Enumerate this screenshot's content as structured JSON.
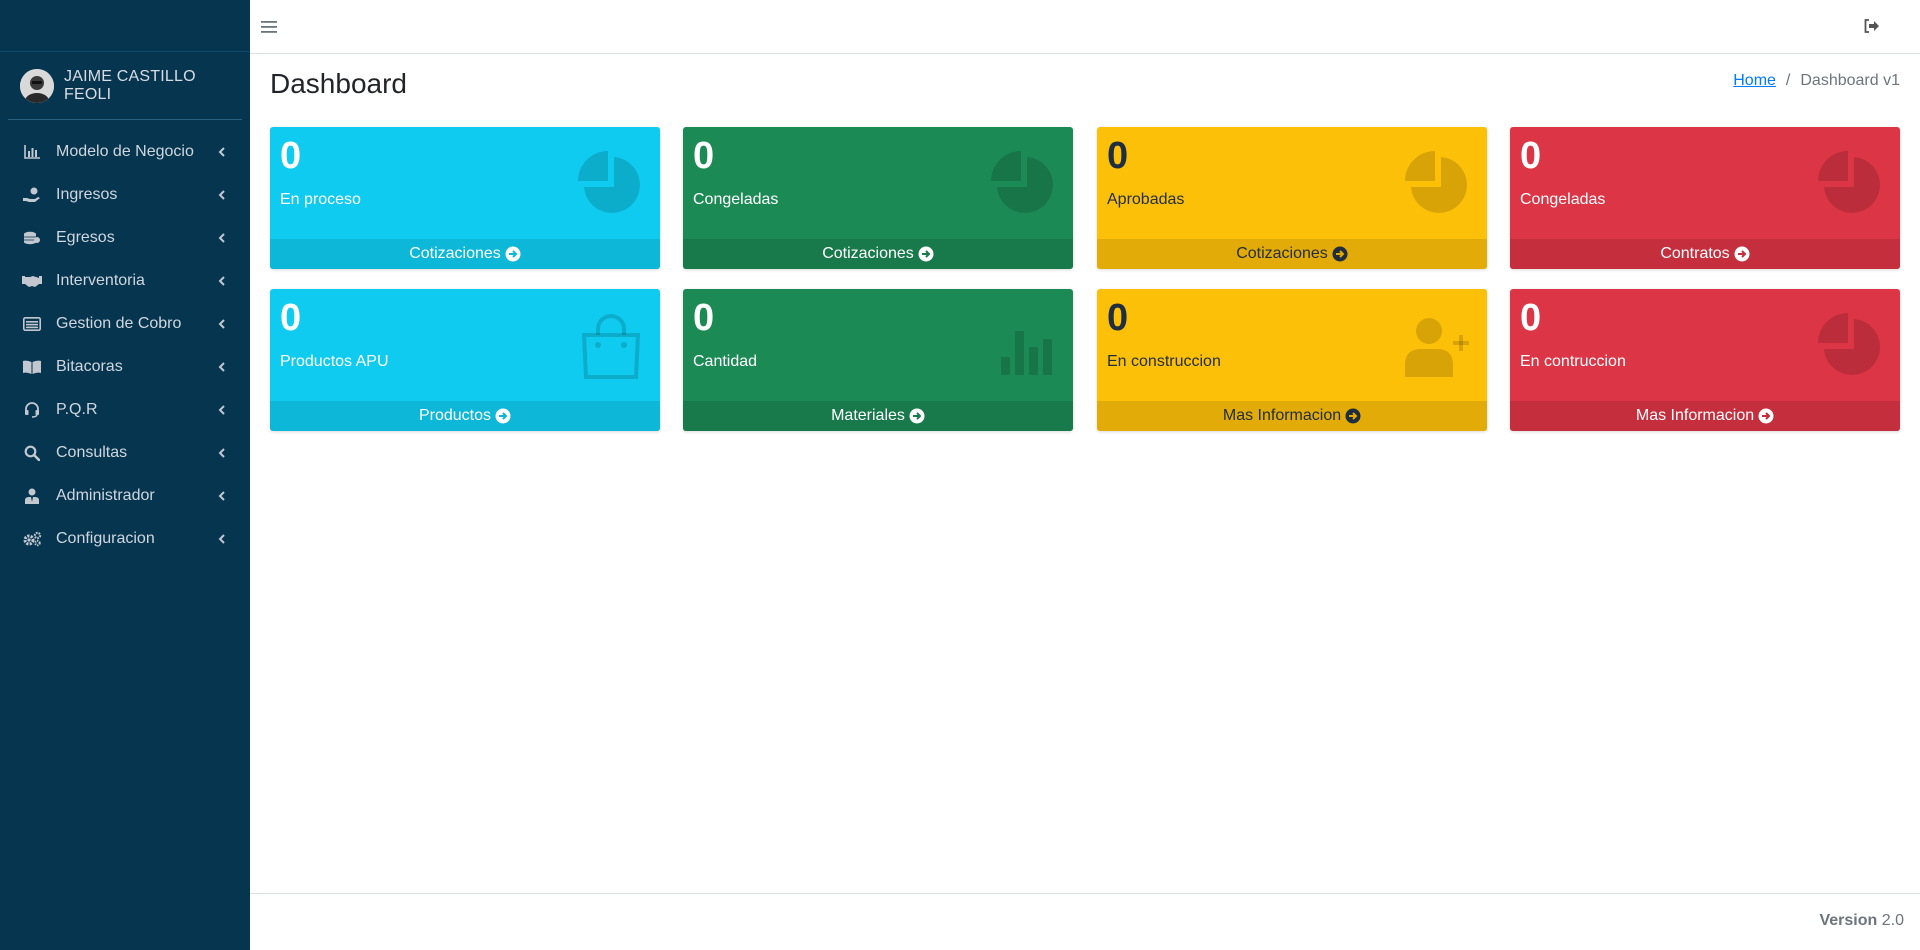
{
  "user": {
    "name": "JAIME CASTILLO FEOLI"
  },
  "sidebar": {
    "items": [
      {
        "label": "Modelo de Negocio",
        "icon": "chart-bar-icon"
      },
      {
        "label": "Ingresos",
        "icon": "hand-coin-icon"
      },
      {
        "label": "Egresos",
        "icon": "coins-icon"
      },
      {
        "label": "Interventoria",
        "icon": "handshake-icon"
      },
      {
        "label": "Gestion de Cobro",
        "icon": "list-alt-icon"
      },
      {
        "label": "Bitacoras",
        "icon": "book-open-icon"
      },
      {
        "label": "P.Q.R",
        "icon": "headset-icon"
      },
      {
        "label": "Consultas",
        "icon": "search-icon"
      },
      {
        "label": "Administrador",
        "icon": "user-tie-icon"
      },
      {
        "label": "Configuracion",
        "icon": "cogs-icon"
      }
    ]
  },
  "main": {
    "title": "Dashboard",
    "breadcrumb": {
      "home": "Home",
      "separator": "/",
      "current": "Dashboard v1"
    }
  },
  "boxes": [
    {
      "value": "0",
      "label": "En proceso",
      "footer": "Cotizaciones",
      "color": "#0fcbef",
      "icon": "pie-chart-icon"
    },
    {
      "value": "0",
      "label": "Congeladas",
      "footer": "Cotizaciones",
      "color": "#1c8a55",
      "icon": "pie-chart-icon"
    },
    {
      "value": "0",
      "label": "Aprobadas",
      "footer": "Cotizaciones",
      "color": "#fdc009",
      "icon": "pie-chart-icon"
    },
    {
      "value": "0",
      "label": "Congeladas",
      "footer": "Contratos",
      "color": "#dc3545",
      "icon": "pie-chart-icon"
    },
    {
      "value": "0",
      "label": "Productos APU",
      "footer": "Productos",
      "color": "#0fcbef",
      "icon": "shopping-bag-icon"
    },
    {
      "value": "0",
      "label": "Cantidad",
      "footer": "Materiales",
      "color": "#1c8a55",
      "icon": "bar-chart-icon"
    },
    {
      "value": "0",
      "label": "En construccion",
      "footer": "Mas Informacion",
      "color": "#fdc009",
      "icon": "user-plus-icon"
    },
    {
      "value": "0",
      "label": "En contruccion",
      "footer": "Mas Informacion",
      "color": "#dc3545",
      "icon": "pie-chart-icon"
    }
  ],
  "footer": {
    "version_label": "Version",
    "version_number": "2.0"
  }
}
